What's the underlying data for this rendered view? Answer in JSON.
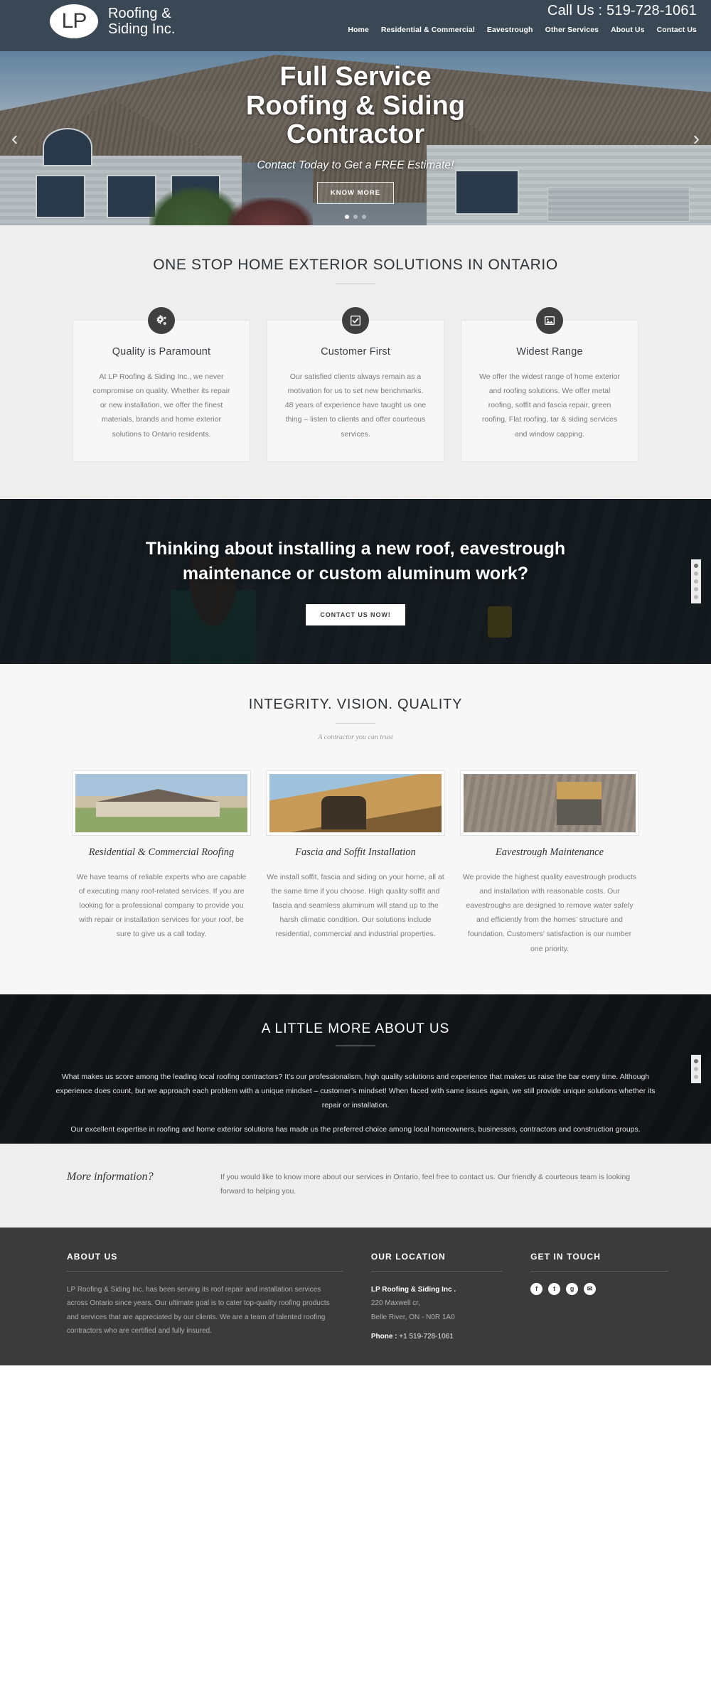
{
  "header": {
    "logo_text": "LP",
    "brand_line1": "Roofing &",
    "brand_line2": "Siding Inc.",
    "call_us": "Call Us : 519-728-1061",
    "nav": [
      {
        "label": "Home"
      },
      {
        "label": "Residential & Commercial"
      },
      {
        "label": "Eavestrough"
      },
      {
        "label": "Other Services"
      },
      {
        "label": "About Us"
      },
      {
        "label": "Contact Us"
      }
    ]
  },
  "hero": {
    "title_line1": "Full Service",
    "title_line2": "Roofing & Siding",
    "title_line3": "Contractor",
    "subtitle": "Contact Today to Get a FREE Estimate!",
    "button": "KNOW MORE",
    "arrow_prev": "‹",
    "arrow_next": "›",
    "slides": 3,
    "active_slide": 1
  },
  "features": {
    "title": "ONE STOP HOME EXTERIOR SOLUTIONS IN ONTARIO",
    "cards": [
      {
        "icon": "gears-icon",
        "glyph": "⚙",
        "title": "Quality is Paramount",
        "body": "At LP Roofing & Siding Inc., we never compromise on quality. Whether its repair or new installation, we offer the finest materials, brands and home exterior solutions to Ontario residents."
      },
      {
        "icon": "checkbox-icon",
        "glyph": "☑",
        "title": "Customer First",
        "body": "Our satisfied clients always remain as a motivation for us to set new benchmarks. 48 years of experience have taught us one thing – listen to clients and offer courteous services."
      },
      {
        "icon": "image-icon",
        "glyph": "ὛB",
        "title": "Widest Range",
        "body": "We offer the widest range of home exterior and roofing solutions. We offer metal roofing, soffit and fascia repair, green roofing, Flat roofing, tar & siding services and window capping."
      }
    ]
  },
  "cta": {
    "title": "Thinking about installing a new roof, eavestrough maintenance or custom aluminum work?",
    "button": "CONTACT US NOW!",
    "dots": 5,
    "active_dot": 1
  },
  "services": {
    "title": "INTEGRITY. VISION. QUALITY",
    "subtitle": "A contractor you can trust",
    "items": [
      {
        "image": "suburban-house-photo",
        "title": "Residential & Commercial Roofing",
        "body": "We have teams of reliable experts who are capable of executing many roof-related services. If you are looking for a professional company to provide you with repair or installation services for your roof, be sure to give us a call today."
      },
      {
        "image": "worker-installing-soffit-photo",
        "title": "Fascia and Soffit Installation",
        "body": "We install soffit, fascia and siding on your home, all at the same time if you choose. High quality soffit and fascia and seamless aluminum will stand up to the harsh climatic condition. Our solutions include residential, commercial and industrial properties."
      },
      {
        "image": "worker-on-ladder-photo",
        "title": "Eavestrough Maintenance",
        "body": "We provide the highest quality eavestrough products and installation with reasonable costs. Our eavestroughs are designed to remove water safely and efficiently from the homes’ structure and foundation. Customers’ satisfaction is our number one priority."
      }
    ]
  },
  "about": {
    "title": "A LITTLE MORE ABOUT US",
    "paragraph1": "What makes us score among the leading local roofing contractors? It’s our professionalism, high quality solutions and experience that makes us raise the bar every time. Although experience does count, but we approach each problem with a unique mindset – customer’s mindset! When faced with same issues again, we still provide unique solutions whether its repair or installation.",
    "paragraph2": "Our excellent expertise in roofing and home exterior solutions has made us the preferred choice among local homeowners, businesses, contractors and construction groups.",
    "dots": 3,
    "active_dot": 1
  },
  "more_info": {
    "heading": "More information?",
    "body": "If you would like to know more about our services in Ontario, feel free to contact us. Our friendly & courteous team is looking forward to helping you."
  },
  "footer": {
    "about": {
      "title": "ABOUT US",
      "body": "LP Roofing & Siding Inc. has been serving its roof repair and installation services across Ontario since years. Our ultimate goal is to cater top-quality roofing products and services that are appreciated by our clients. We are a team of talented roofing contractors who are certified and fully insured."
    },
    "location": {
      "title": "OUR LOCATION",
      "company": "LP Roofing & Siding Inc .",
      "address1": "220 Maxwell cr,",
      "address2": "Belle River, ON - N0R 1A0",
      "phone_label": "Phone :",
      "phone_value": "+1 519-728-1061"
    },
    "touch": {
      "title": "GET IN TOUCH",
      "socials": [
        {
          "name": "facebook-icon",
          "glyph": "f"
        },
        {
          "name": "twitter-icon",
          "glyph": "t"
        },
        {
          "name": "google-plus-icon",
          "glyph": "g"
        },
        {
          "name": "email-icon",
          "glyph": "✉"
        }
      ]
    }
  }
}
